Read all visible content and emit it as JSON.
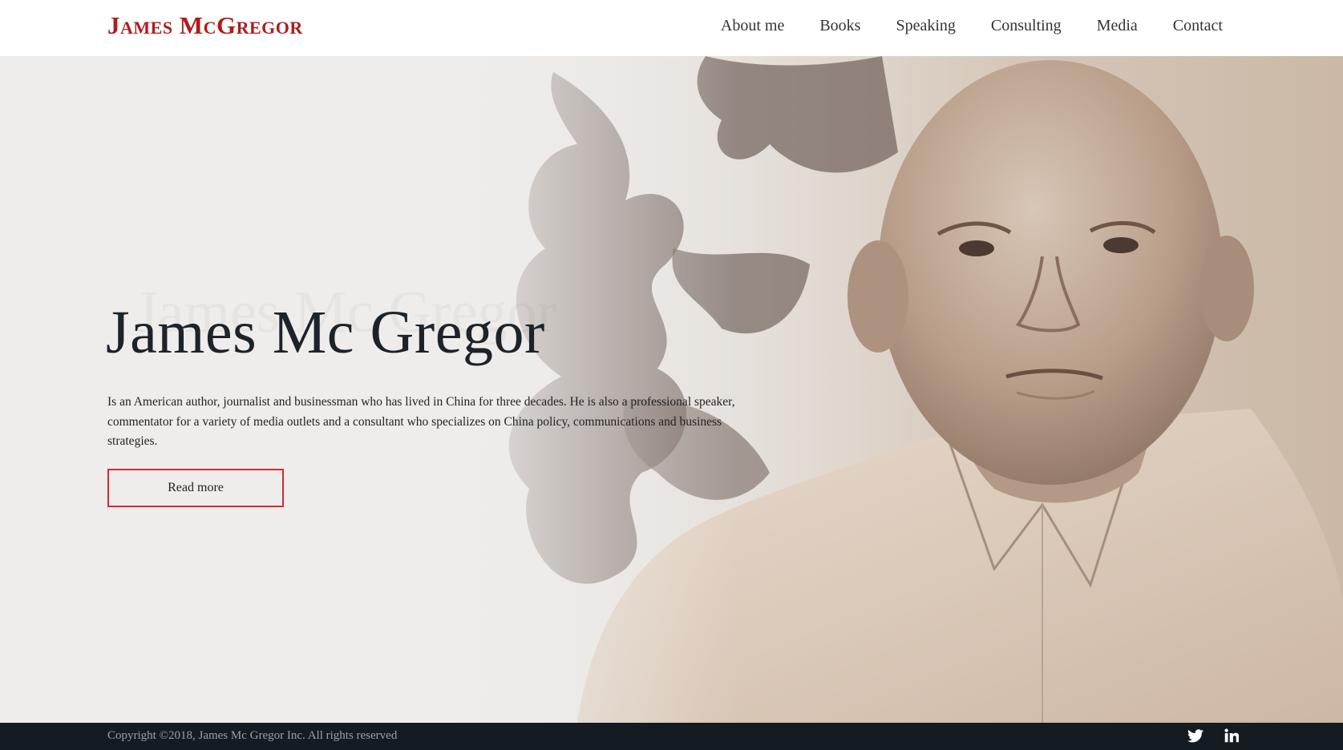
{
  "header": {
    "logo": "James McGregor",
    "nav": [
      "About me",
      "Books",
      "Speaking",
      "Consulting",
      "Media",
      "Contact"
    ]
  },
  "hero": {
    "ghost_title": "James Mc Gregor",
    "title": "James Mc Gregor",
    "description": "Is an American author, journalist and businessman who has lived in China for three decades. He is also a professional speaker, commentator for a variety of media outlets and a consultant who specializes on China policy, communications and business strategies.",
    "button_label": "Read more"
  },
  "footer": {
    "copyright": "Copyright ©2018, James Mc Gregor Inc. All rights reserved",
    "social": [
      "twitter-icon",
      "linkedin-icon"
    ]
  },
  "colors": {
    "accent": "#b01c1c",
    "button_border": "#d62a2a",
    "footer_bg": "#141c22",
    "title": "#1c232b"
  }
}
